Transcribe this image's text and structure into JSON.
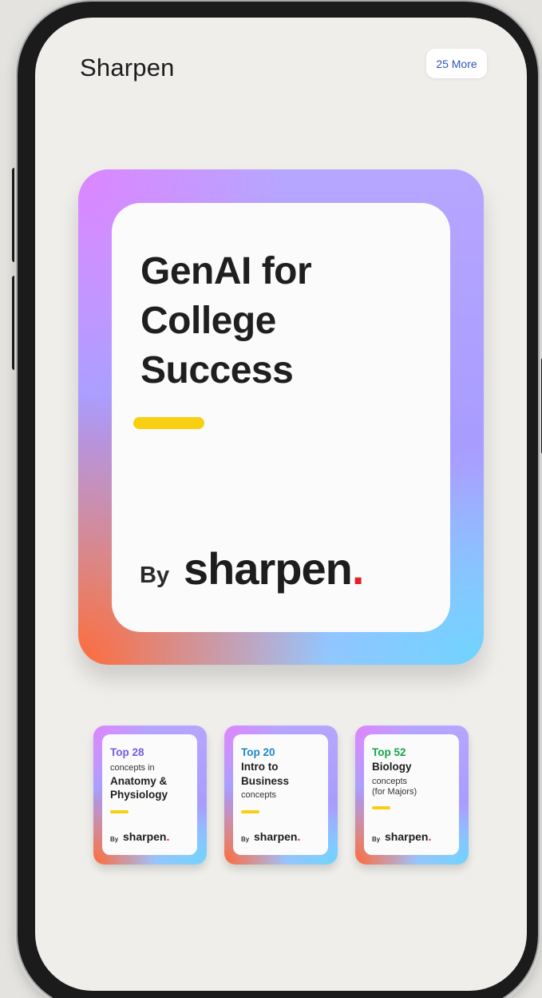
{
  "app": {
    "title": "Sharpen"
  },
  "header": {
    "more_label": "25 More"
  },
  "hero": {
    "title_lines": [
      "GenAI for",
      "College",
      "Success"
    ],
    "by": "By",
    "brand": "sharpen",
    "brand_dot": "."
  },
  "cards": [
    {
      "top": "Top 28",
      "top_color": "#6f5ee6",
      "lines": [
        {
          "text": "concepts in",
          "style": "small"
        },
        {
          "text": "Anatomy &",
          "style": "big"
        },
        {
          "text": "Physiology",
          "style": "big"
        }
      ],
      "by": "By",
      "brand": "sharpen",
      "brand_dot": "."
    },
    {
      "top": "Top 20",
      "top_color": "#1f86c9",
      "lines": [
        {
          "text": "Intro to",
          "style": "big"
        },
        {
          "text": "Business",
          "style": "big"
        },
        {
          "text": "concepts",
          "style": "small"
        }
      ],
      "by": "By",
      "brand": "sharpen",
      "brand_dot": "."
    },
    {
      "top": "Top 52",
      "top_color": "#16a34a",
      "lines": [
        {
          "text": "Biology",
          "style": "big"
        },
        {
          "text": "concepts",
          "style": "small"
        },
        {
          "text": "(for Majors)",
          "style": "small"
        }
      ],
      "by": "By",
      "brand": "sharpen",
      "brand_dot": "."
    }
  ],
  "colors": {
    "accent_yellow": "#f9cf12",
    "brand_red": "#e3212b",
    "link_blue": "#2b56b8"
  }
}
